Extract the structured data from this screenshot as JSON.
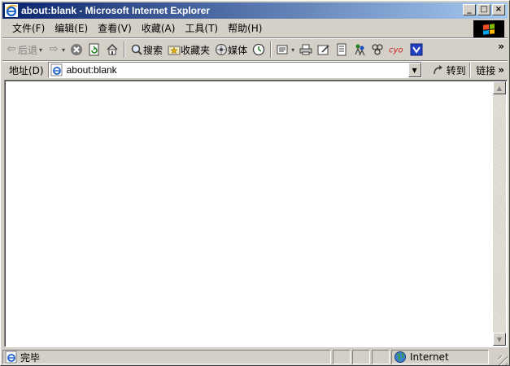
{
  "window": {
    "title": "about:blank - Microsoft Internet Explorer"
  },
  "caption_buttons": {
    "minimize": "_",
    "maximize": "□",
    "close": "×"
  },
  "menu": [
    {
      "label": "文件(F)"
    },
    {
      "label": "编辑(E)"
    },
    {
      "label": "查看(V)"
    },
    {
      "label": "收藏(A)"
    },
    {
      "label": "工具(T)"
    },
    {
      "label": "帮助(H)"
    }
  ],
  "toolbar": {
    "back_label": "后退",
    "search_label": "搜索",
    "favorites_label": "收藏夹",
    "media_label": "媒体",
    "overflow": "»"
  },
  "address": {
    "label": "地址(D)",
    "value": "about:blank",
    "go_label": "转到",
    "links_label": "链接",
    "links_overflow": "»"
  },
  "status": {
    "text": "完毕",
    "zone": "Internet"
  },
  "colors": {
    "titlebar_start": "#0a246a",
    "titlebar_end": "#a6caf0",
    "chrome": "#d4d0c8"
  }
}
